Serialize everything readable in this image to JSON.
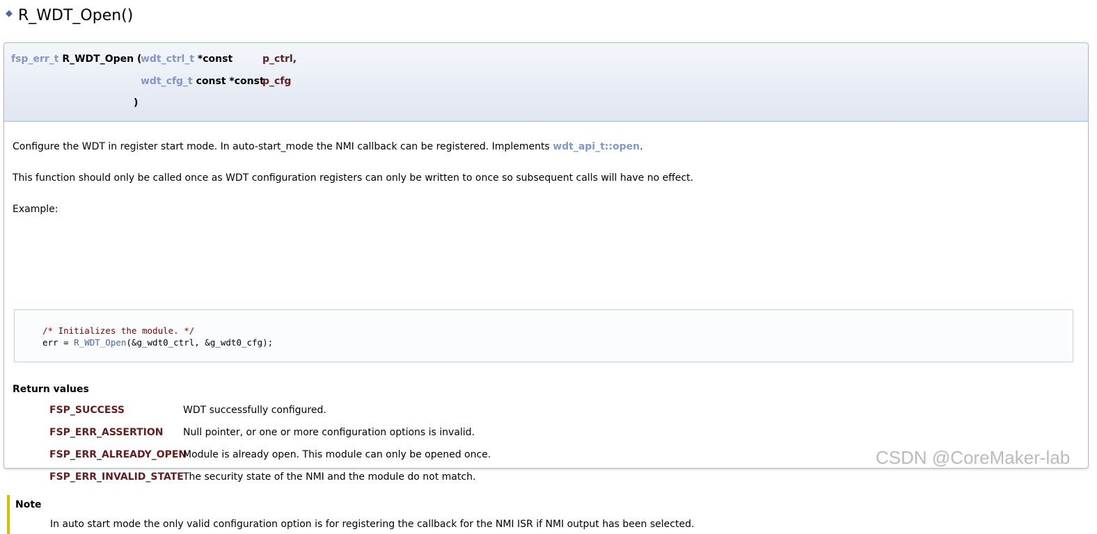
{
  "title": "R_WDT_Open()",
  "prototype": {
    "return_type": "fsp_err_t",
    "function_name": "R_WDT_Open",
    "open_paren": "(",
    "params": [
      {
        "type": "wdt_ctrl_t",
        "qualifier": "*const",
        "name": "p_ctrl,"
      },
      {
        "type": "wdt_cfg_t",
        "qualifier": "const *const",
        "name": "p_cfg"
      }
    ],
    "close_paren": ")"
  },
  "description": {
    "line1_text": "Configure the WDT in register start mode. In auto-start_mode the NMI callback can be registered. Implements ",
    "line1_link": "wdt_api_t::open",
    "line1_end": ".",
    "line2": "This function should only be called once as WDT configuration registers can only be written to once so subsequent calls will have no effect.",
    "example_label": "Example:"
  },
  "code": {
    "comment": "/* Initializes the module. */",
    "line2_prefix": "err = ",
    "line2_func": "R_WDT_Open",
    "line2_args": "(&g_wdt0_ctrl, &g_wdt0_cfg);"
  },
  "return_values": {
    "heading": "Return values",
    "items": [
      {
        "name": "FSP_SUCCESS",
        "desc": "WDT successfully configured."
      },
      {
        "name": "FSP_ERR_ASSERTION",
        "desc": "Null pointer, or one or more configuration options is invalid."
      },
      {
        "name": "FSP_ERR_ALREADY_OPEN",
        "desc": "Module is already open. This module can only be opened once."
      },
      {
        "name": "FSP_ERR_INVALID_STATE",
        "desc": "The security state of the NMI and the module do not match."
      }
    ]
  },
  "note": {
    "heading": "Note",
    "text": "In auto start mode the only valid configuration option is for registering the callback for the NMI ISR if NMI output has been selected."
  },
  "watermark": "CSDN @CoreMaker-lab",
  "colors": {
    "link": "#4665a2",
    "param": "#602020",
    "note_bar": "#d0c000"
  }
}
